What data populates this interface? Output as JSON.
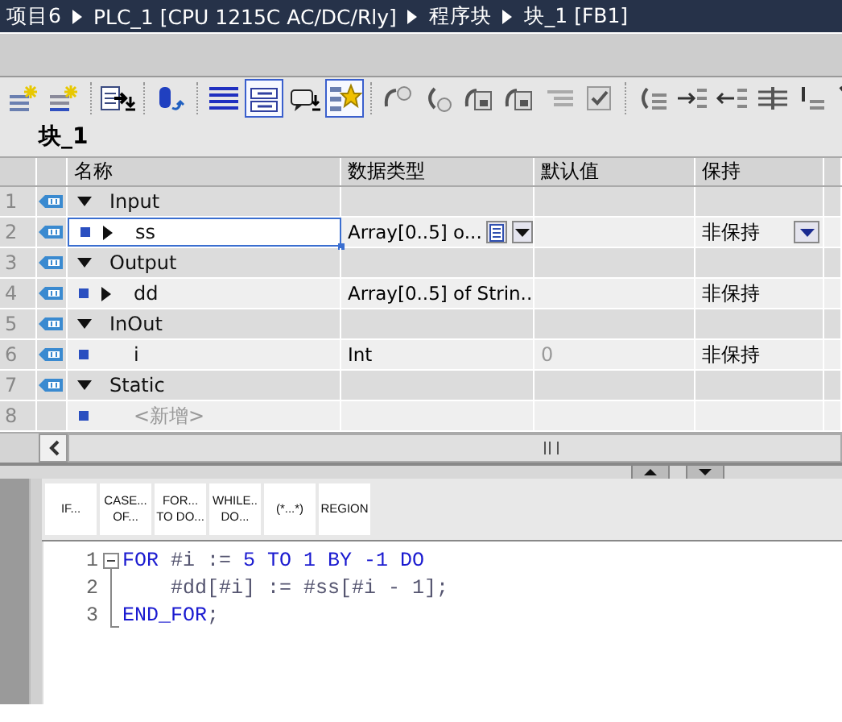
{
  "breadcrumb": [
    "项目6",
    "PLC_1 [CPU 1215C AC/DC/Rly]",
    "程序块",
    "块_1 [FB1]"
  ],
  "toolbar": [
    {
      "kind": "insert",
      "selected": false
    },
    {
      "kind": "append",
      "selected": false
    },
    {
      "kind": "export",
      "selected": false
    },
    {
      "kind": "database",
      "selected": false
    },
    {
      "kind": "list",
      "selected": false
    },
    {
      "kind": "tags",
      "selected": true
    },
    {
      "kind": "comment",
      "selected": false
    },
    {
      "kind": "star",
      "selected": true
    },
    {
      "kind": "breakpoint",
      "selected": false
    },
    {
      "kind": "stepover",
      "selected": false
    },
    {
      "kind": "monitor",
      "selected": false
    },
    {
      "kind": "monitor",
      "selected": false
    },
    {
      "kind": "indent",
      "selected": false
    },
    {
      "kind": "check",
      "selected": false
    },
    {
      "kind": "jump",
      "selected": false
    },
    {
      "kind": "indentin",
      "selected": false
    },
    {
      "kind": "indentout",
      "selected": false
    },
    {
      "kind": "columns",
      "selected": false
    },
    {
      "kind": "bars",
      "selected": false
    },
    {
      "kind": "slash",
      "selected": false
    }
  ],
  "block_title": "块_1",
  "table": {
    "columns": [
      "名称",
      "数据类型",
      "默认值",
      "保持"
    ],
    "rows": [
      {
        "num": "1",
        "kind": "section",
        "expanded": true,
        "name": "Input",
        "selected": false
      },
      {
        "num": "2",
        "kind": "variable",
        "expanded": false,
        "name": "ss",
        "data_type": "Array[0..5] o...",
        "retain": "非保持",
        "selected": true
      },
      {
        "num": "3",
        "kind": "section",
        "expanded": true,
        "name": "Output",
        "selected": false
      },
      {
        "num": "4",
        "kind": "variable",
        "expanded": false,
        "name": "dd",
        "data_type": "Array[0..5] of Strin...",
        "retain": "非保持",
        "selected": false
      },
      {
        "num": "5",
        "kind": "section",
        "expanded": true,
        "name": "InOut",
        "selected": false
      },
      {
        "num": "6",
        "kind": "variable",
        "name": "i",
        "data_type": "Int",
        "default": "0",
        "retain": "非保持",
        "selected": false
      },
      {
        "num": "7",
        "kind": "section",
        "expanded": true,
        "name": "Static",
        "selected": false
      },
      {
        "num": "8",
        "kind": "placeholder",
        "name": "<新增>",
        "selected": false
      }
    ]
  },
  "instructions": [
    "IF...",
    "CASE...\nOF...",
    "FOR...\nTO DO...",
    "WHILE..\nDO...",
    "(*...*)",
    "REGION"
  ],
  "code": [
    {
      "num": "1",
      "kind": "start",
      "expanded": true,
      "tokens": [
        {
          "text": "FOR",
          "kind": "keyword"
        },
        {
          "text": " #i := ",
          "kind": "plain"
        },
        {
          "text": "5 TO 1 BY -1 DO",
          "kind": "keyword"
        }
      ]
    },
    {
      "num": "2",
      "kind": "inside",
      "tokens": [
        {
          "text": "    #dd[#i] := #ss[#i - 1];",
          "kind": "plain"
        }
      ]
    },
    {
      "num": "3",
      "kind": "end",
      "tokens": [
        {
          "text": "END_FOR",
          "kind": "keyword"
        },
        {
          "text": ";",
          "kind": "plain"
        }
      ]
    }
  ]
}
